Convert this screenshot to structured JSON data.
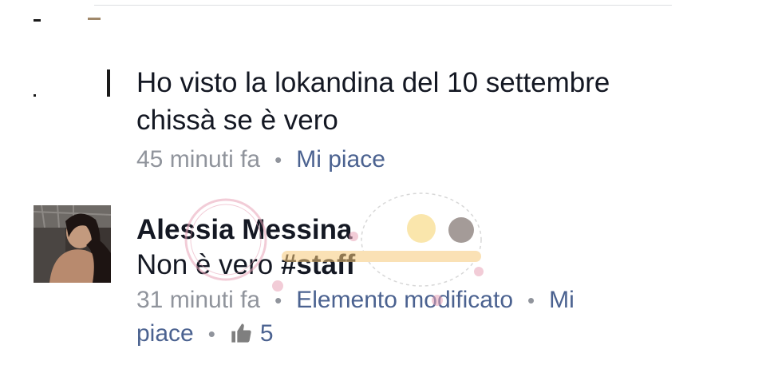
{
  "comments": [
    {
      "text_lines": [
        "Ho visto la lokandina del 10 settembre",
        "chissà se è vero"
      ],
      "timestamp": "45 minuti fa",
      "like_label": "Mi piace"
    },
    {
      "author": "Alessia Messina",
      "text_plain": "Non è vero ",
      "hashtag": "#staff",
      "timestamp": "31 minuti fa",
      "edited_label": "Elemento modificato",
      "like_label_part1": "Mi",
      "like_label_part2": "piace",
      "like_count": "5"
    }
  ],
  "separator": "•",
  "icons": {
    "like": "thumbs-up-icon"
  },
  "colors": {
    "text": "#141823",
    "meta": "#90949c",
    "link": "#4b6290",
    "like_icon": "#7f7f7f",
    "watermark_pink": "#e8a4b8"
  }
}
